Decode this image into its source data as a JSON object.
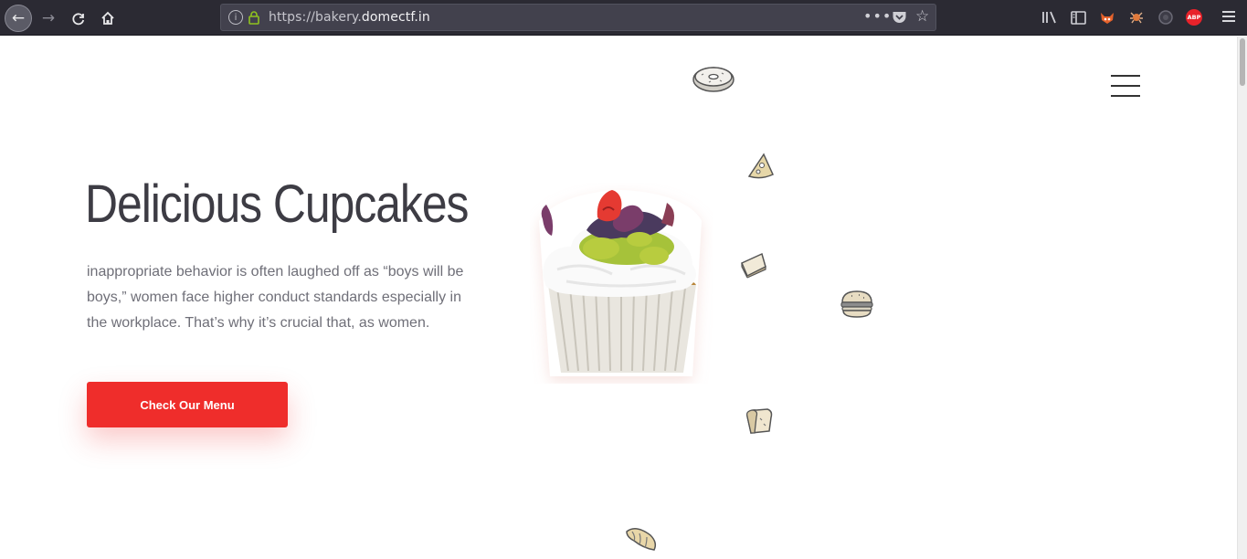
{
  "browser": {
    "url_prefix": "https://bakery.",
    "url_domain": "domectf.in",
    "more_icon": "more-horizontal-icon",
    "abp_label": "ABP"
  },
  "hero": {
    "title": "Delicious Cupcakes",
    "description": "inappropriate behavior is often laughed off as “boys will be boys,” women face higher conduct standards especially in the workplace. That’s why it’s crucial that, as women.",
    "cta_label": "Check Our Menu"
  },
  "colors": {
    "accent": "#ef2d2b",
    "title": "#3d3c44",
    "body_text": "#6f6f78",
    "chrome_bg": "#2b2a33"
  },
  "decorations": [
    "donut-icon",
    "pizza-slice-icon",
    "cake-slice-icon",
    "burger-icon",
    "bread-icon",
    "croissant-icon",
    "cupcake-image"
  ]
}
